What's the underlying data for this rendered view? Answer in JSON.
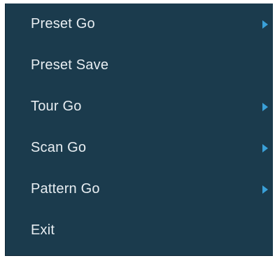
{
  "menu": {
    "items": [
      {
        "label": "Preset Go",
        "has_submenu": true
      },
      {
        "label": "Preset Save",
        "has_submenu": false
      },
      {
        "label": "Tour Go",
        "has_submenu": true
      },
      {
        "label": "Scan Go",
        "has_submenu": true
      },
      {
        "label": "Pattern Go",
        "has_submenu": true
      },
      {
        "label": "Exit",
        "has_submenu": false
      }
    ],
    "background_color": "#1b3b4d",
    "text_color": "#e8eef2",
    "arrow_color": "#3aa0d8",
    "arrow_icon": "submenu-arrow-icon"
  }
}
